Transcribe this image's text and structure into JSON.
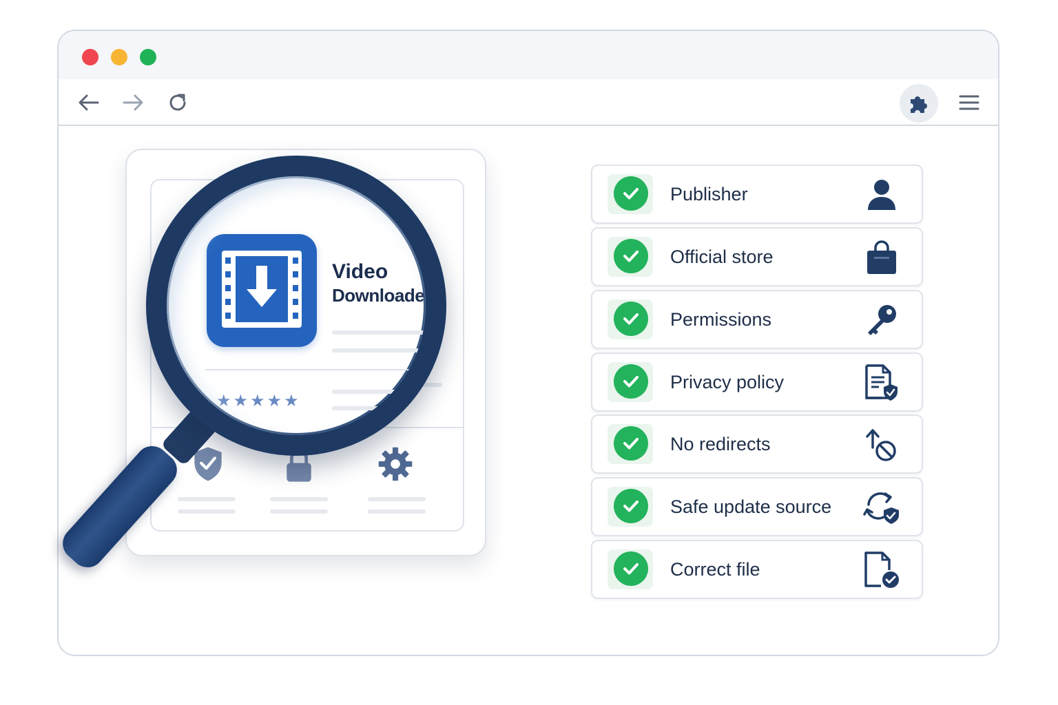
{
  "browser": {
    "controls": [
      "close",
      "minimize",
      "maximize"
    ],
    "toolbar": {
      "back_icon": "arrow-left-icon",
      "forward_icon": "arrow-right-icon",
      "reload_icon": "reload-icon",
      "extensions_icon": "puzzle-icon",
      "menu_icon": "hamburger-menu-icon"
    }
  },
  "extension_card": {
    "app_name_line1": "Video",
    "app_name_line2": "Downloader",
    "rating_stars": "★★★★★",
    "rating": 5,
    "feature_icons": [
      "shield-check-icon",
      "lock-icon",
      "gear-icon"
    ]
  },
  "checklist": {
    "items": [
      {
        "label": "Publisher",
        "icon": "person-icon",
        "checked": true
      },
      {
        "label": "Official store",
        "icon": "shopping-bag-icon",
        "checked": true
      },
      {
        "label": "Permissions",
        "icon": "key-icon",
        "checked": true
      },
      {
        "label": "Privacy policy",
        "icon": "document-shield-icon",
        "checked": true
      },
      {
        "label": "No redirects",
        "icon": "no-redirect-icon",
        "checked": true
      },
      {
        "label": "Safe update source",
        "icon": "sync-shield-icon",
        "checked": true
      },
      {
        "label": "Correct file",
        "icon": "file-check-icon",
        "checked": true
      }
    ]
  },
  "colors": {
    "accent_blue": "#2564be",
    "navy": "#1e3a63",
    "check_green": "#23b35c",
    "close_red": "#ef4650",
    "minimize_yellow": "#f8b533",
    "maximize_green": "#20b256"
  }
}
